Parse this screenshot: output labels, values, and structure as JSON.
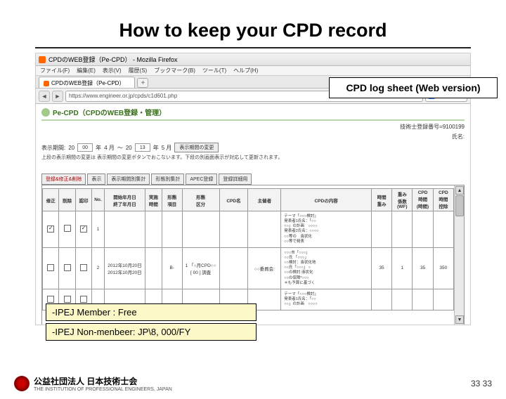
{
  "slide": {
    "title": "How to keep your CPD record"
  },
  "browser": {
    "window_title": "CPDのWEB登録（Pe-CPD） - Mozilla Firefox",
    "menu": [
      "ファイル(F)",
      "編集(E)",
      "表示(V)",
      "履歴(S)",
      "ブックマーク(B)",
      "ツール(T)",
      "ヘルプ(H)"
    ],
    "tab": {
      "label": "CPDのWEB登録（Pe-CPD）",
      "plus": "+"
    },
    "url": "https://www.engineer.or.jp/cpds/c1d601.php",
    "url_icons": {
      "star": "☆",
      "reload": "⟳",
      "dropdown": "▾"
    },
    "searchbox_prefix": "N"
  },
  "page": {
    "header_title": "Pe-CPD（CPDのWEB登録・管理）",
    "reg_no_label": "技術士登録番号=",
    "reg_no_value": "9100199",
    "name_label": "氏名:",
    "period": {
      "label": "表示期間:",
      "from_year": "00",
      "from_prefix": "20",
      "from_suffix": "年",
      "from_month": "4 月",
      "tilde": "～",
      "to_prefix": "20",
      "to_year": "13",
      "to_suffix": "年",
      "to_month": "5 月",
      "change_btn": "表示期間の変更"
    },
    "note": "上段の表示期間の変更は 表示期間の変更ボタンでおこないます。下段の別画面表示が対応して更新されます。"
  },
  "actions": [
    "登録&修正&削除",
    "表示",
    "表示期間別集計",
    "形態別集計",
    "APEC登録",
    "登録詳細用"
  ],
  "table": {
    "headers": [
      "修正",
      "削除",
      "認印",
      "No.",
      "開始年月日\n終了年月日",
      "実施\n時間",
      "形態\n項目",
      "形態\n区分",
      "CPD名",
      "主催者",
      "CPDの内容",
      "時間\n重み",
      "重み\n係数\n(WF)",
      "CPD\n時間\n(時間)",
      "CPD\n時間\n控除"
    ],
    "rows": [
      {
        "mod": true,
        "del": false,
        "stamp": true,
        "no": "1",
        "date": "",
        "hours": "",
        "ftype": "",
        "fclass": "",
        "name": "",
        "org": "",
        "content": "テーマ「○○○検討」\n発表者1氏名：「○○\n○○」の計画　○○○○\n発表者2氏名：○○○○\n○○等の　液状化\n○○等で発表",
        "hwt": "",
        "wf": "",
        "cpdh": "",
        "ded": ""
      },
      {
        "mod": false,
        "del": false,
        "stamp": false,
        "no": "2",
        "date": "2012年10月20日\n2012年10月20日",
        "hours": "",
        "ftype": "B-",
        "fclass": "1 「○月CPD○○\n[ 00 ] 調査",
        "name": "",
        "org": "○○委員会:",
        "content": "○○○市「○○○」\n○○氏 「○○○」\n○○検討：液状化地\n○○氏「○○○」 ○\n○○の検討 液状化\n○○の保障*○○○\n＊も予算に基づく",
        "hwt": "35",
        "wf": "1",
        "cpdh": "35",
        "ded": "350"
      },
      {
        "mod": false,
        "del": false,
        "stamp": false,
        "no": "",
        "date": "",
        "hours": "",
        "ftype": "",
        "fclass": "",
        "name": "",
        "org": "",
        "content": "テーマ「○○○検討」\n発表者1氏名：「○○\n○○」の計画　○○○○",
        "hwt": "",
        "wf": "",
        "cpdh": "",
        "ded": ""
      }
    ]
  },
  "callout": "CPD log sheet (Web version)",
  "notes": {
    "n1": "-IPEJ Member : Free",
    "n2": "-IPEJ Non-menbeer: JP\\8, 000/FY"
  },
  "footer": {
    "jp_label": "公益社団法人 日本技術士会",
    "en_label": "THE INSTITUTION OF PROFESSIONAL ENGINEERS, JAPAN",
    "page_a": "33",
    "page_b": "33"
  }
}
